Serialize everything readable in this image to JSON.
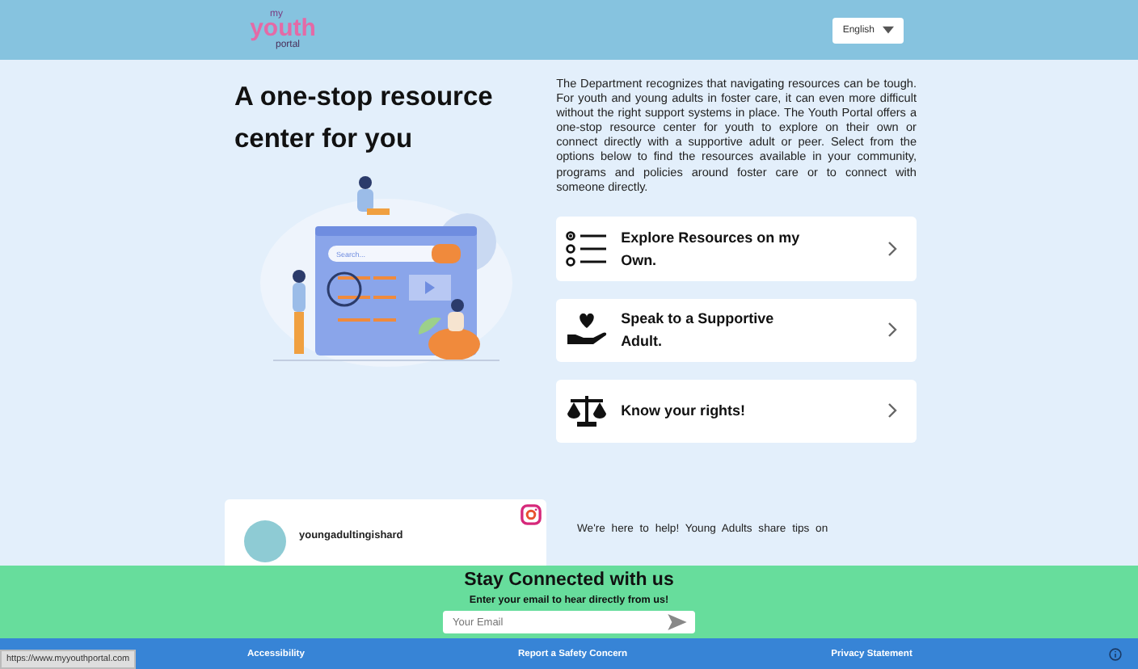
{
  "header": {
    "logo": {
      "top": "my",
      "middle": "youth",
      "bottom": "portal"
    },
    "language": "English"
  },
  "hero": {
    "heading": "A one-stop resource center for you",
    "illustration_search": "Search...",
    "intro": "The Department recognizes that navigating resources can be tough. For youth and young adults in foster care, it can even more difficult without the right support systems in place. The Youth Portal offers a one-stop resource center for youth to explore on their own or connect directly with a supportive adult or peer. Select from the options below to find the resources available in your community, programs and policies around foster care or to connect with someone directly."
  },
  "options": [
    {
      "kind": "list",
      "label": "Explore Resources on my Own."
    },
    {
      "kind": "support",
      "label": "Speak to a Supportive Adult."
    },
    {
      "kind": "rights",
      "label": "Know your rights!"
    }
  ],
  "social": {
    "account": "youngadultingishard",
    "blurb": "We're here to help! Young Adults share tips on"
  },
  "newsletter": {
    "title": "Stay Connected with us",
    "subtitle": "Enter your email to hear directly from us!",
    "placeholder": "Your Email"
  },
  "footer": {
    "links": [
      "Accessibility",
      "Report a Safety Concern",
      "Privacy Statement"
    ]
  },
  "status_url": "https://www.myyouthportal.com"
}
